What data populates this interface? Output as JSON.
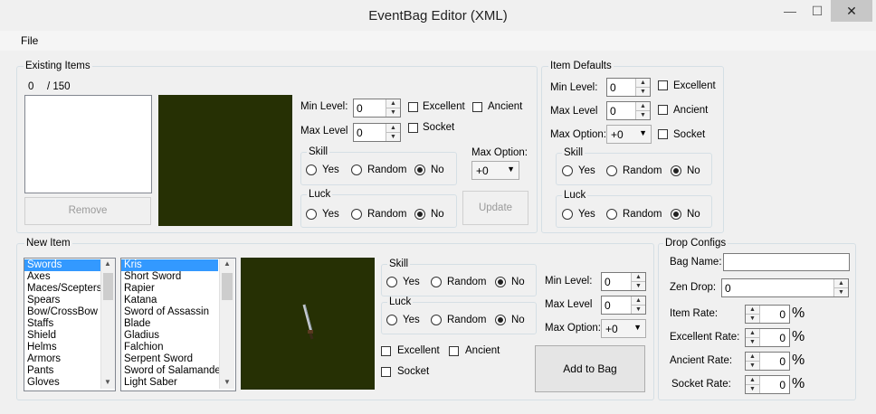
{
  "window": {
    "title": "EventBag Editor (XML)",
    "min_glyph": "—",
    "max_glyph": "☐",
    "close_glyph": "✕"
  },
  "menu": {
    "file": "File"
  },
  "existing": {
    "title": "Existing Items",
    "count": "0",
    "total": "/ 150",
    "remove": "Remove",
    "min_level_label": "Min Level:",
    "min_level": "0",
    "max_level_label": "Max Level",
    "max_level": "0",
    "excellent": "Excellent",
    "ancient": "Ancient",
    "socket": "Socket",
    "skill_label": "Skill",
    "luck_label": "Luck",
    "yes": "Yes",
    "random": "Random",
    "no": "No",
    "max_option_label": "Max Option:",
    "max_option": "+0",
    "update": "Update"
  },
  "defaults": {
    "title": "Item Defaults",
    "min_level_label": "Min Level:",
    "min_level": "0",
    "max_level_label": "Max Level",
    "max_level": "0",
    "max_option_label": "Max Option:",
    "max_option": "+0",
    "excellent": "Excellent",
    "ancient": "Ancient",
    "socket": "Socket",
    "skill_label": "Skill",
    "luck_label": "Luck",
    "yes": "Yes",
    "random": "Random",
    "no": "No"
  },
  "newitem": {
    "title": "New Item",
    "categories": [
      "Swords",
      "Axes",
      "Maces/Scepters",
      "Spears",
      "Bow/CrossBow",
      "Staffs",
      "Shield",
      "Helms",
      "Armors",
      "Pants",
      "Gloves"
    ],
    "items": [
      "Kris",
      "Short Sword",
      "Rapier",
      "Katana",
      "Sword of Assassin",
      "Blade",
      "Gladius",
      "Falchion",
      "Serpent Sword",
      "Sword of Salamander",
      "Light Saber"
    ],
    "skill_label": "Skill",
    "luck_label": "Luck",
    "yes": "Yes",
    "random": "Random",
    "no": "No",
    "excellent": "Excellent",
    "ancient": "Ancient",
    "socket": "Socket",
    "min_level_label": "Min Level:",
    "min_level": "0",
    "max_level_label": "Max Level",
    "max_level": "0",
    "max_option_label": "Max Option:",
    "max_option": "+0",
    "add": "Add to Bag"
  },
  "drop": {
    "title": "Drop Configs",
    "bag_name_label": "Bag Name:",
    "bag_name": "",
    "zen_drop_label": "Zen Drop:",
    "zen_drop": "0",
    "item_rate_label": "Item Rate:",
    "item_rate": "0",
    "excellent_rate_label": "Excellent Rate:",
    "excellent_rate": "0",
    "ancient_rate_label": "Ancient Rate:",
    "ancient_rate": "0",
    "socket_rate_label": "Socket Rate:",
    "socket_rate": "0",
    "percent": "%"
  },
  "colors": {
    "preview_bg": "#263004",
    "selection": "#3399ff"
  }
}
